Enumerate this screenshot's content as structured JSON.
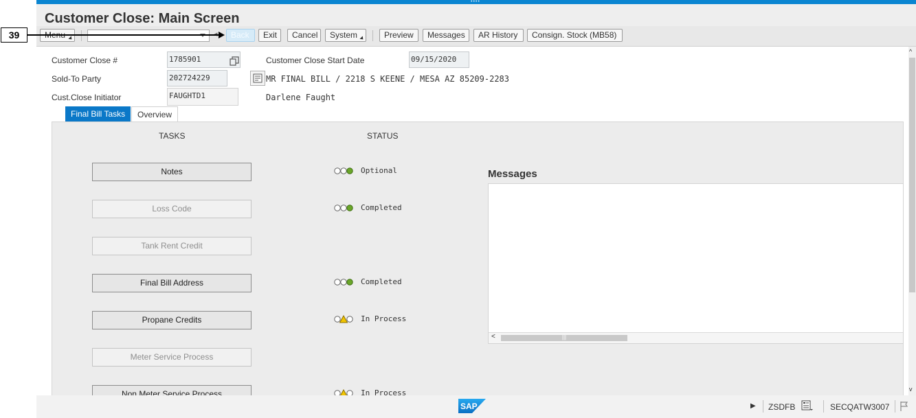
{
  "callout": {
    "number": "39"
  },
  "window": {
    "title": "Customer Close: Main Screen"
  },
  "toolbar": {
    "menu_label": "Menu",
    "back_label": "Back",
    "exit_label": "Exit",
    "cancel_label": "Cancel",
    "system_label": "System",
    "preview_label": "Preview",
    "messages_label": "Messages",
    "ar_history_label": "AR History",
    "consign_stock_label": "Consign. Stock (MB58)",
    "command_field_value": ""
  },
  "header": {
    "customer_close_no_label": "Customer Close #",
    "customer_close_no_value": "1785901",
    "start_date_label": "Customer Close Start Date",
    "start_date_value": "09/15/2020",
    "sold_to_label": "Sold-To Party",
    "sold_to_value": "202724229",
    "sold_to_address": "MR FINAL BILL / 2218 S KEENE / MESA AZ 85209-2283",
    "initiator_label": "Cust.Close Initiator",
    "initiator_value": "FAUGHTD1",
    "initiator_name": "Darlene Faught"
  },
  "tabs": [
    {
      "label": "Final Bill Tasks",
      "active": true
    },
    {
      "label": "Overview",
      "active": false
    }
  ],
  "panel": {
    "tasks_header": "TASKS",
    "status_header": "STATUS",
    "tasks": [
      {
        "label": "Notes",
        "enabled": true,
        "status": "Optional",
        "light": "green"
      },
      {
        "label": "Loss Code",
        "enabled": false,
        "status": "Completed",
        "light": "green"
      },
      {
        "label": "Tank Rent Credit",
        "enabled": false,
        "status": "",
        "light": "none"
      },
      {
        "label": "Final Bill Address",
        "enabled": true,
        "status": "Completed",
        "light": "green"
      },
      {
        "label": "Propane Credits",
        "enabled": true,
        "status": "In Process",
        "light": "yellow"
      },
      {
        "label": "Meter Service Process",
        "enabled": false,
        "status": "",
        "light": "none"
      },
      {
        "label": "Non Meter Service Process",
        "enabled": true,
        "status": "In Process",
        "light": "yellow"
      }
    ],
    "messages_title": "Messages"
  },
  "statusbar": {
    "logo_text": "SAP",
    "transaction": "ZSDFB",
    "system": "SECQATW3007"
  },
  "colors": {
    "accent": "#0a78c8",
    "light_green": "#6aa629",
    "light_yellow": "#f2c500"
  }
}
